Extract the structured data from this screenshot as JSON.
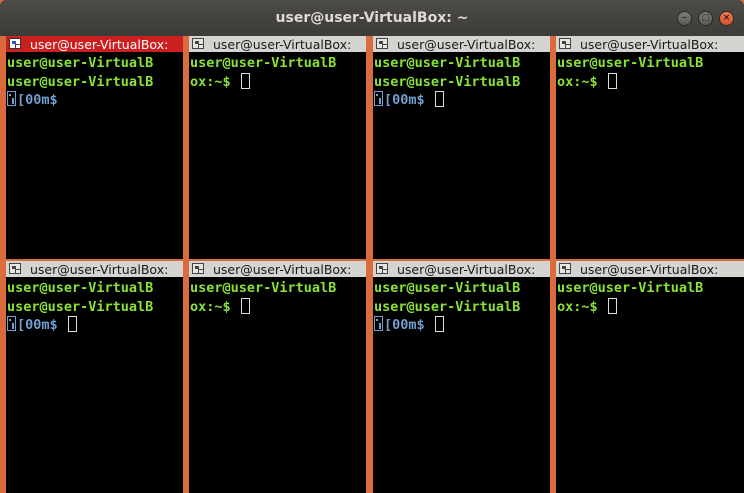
{
  "window": {
    "title": "user@user-VirtualBox: ~",
    "buttons": {
      "minimize": "–",
      "maximize": "□",
      "close": "×"
    }
  },
  "terminal": {
    "prompt_user": "user@user-VirtualB",
    "prompt_wrap": "ox:~$",
    "escape_text": "[00m$"
  },
  "panes": [
    {
      "title": "user@user-VirtualBox:",
      "active": true
    },
    {
      "title": "user@user-VirtualBox:",
      "active": false
    },
    {
      "title": "user@user-VirtualBox:",
      "active": false
    },
    {
      "title": "user@user-VirtualBox:",
      "active": false
    },
    {
      "title": "user@user-VirtualBox:",
      "active": false
    },
    {
      "title": "user@user-VirtualBox:",
      "active": false
    },
    {
      "title": "user@user-VirtualBox:",
      "active": false
    },
    {
      "title": "user@user-VirtualBox:",
      "active": false
    }
  ],
  "colors": {
    "active_bar": "#cc2020",
    "inactive_bar": "#d6d4d0",
    "prompt_green": "#8ae234",
    "escape_blue": "#729fcf",
    "divider": "#d96b3d"
  }
}
